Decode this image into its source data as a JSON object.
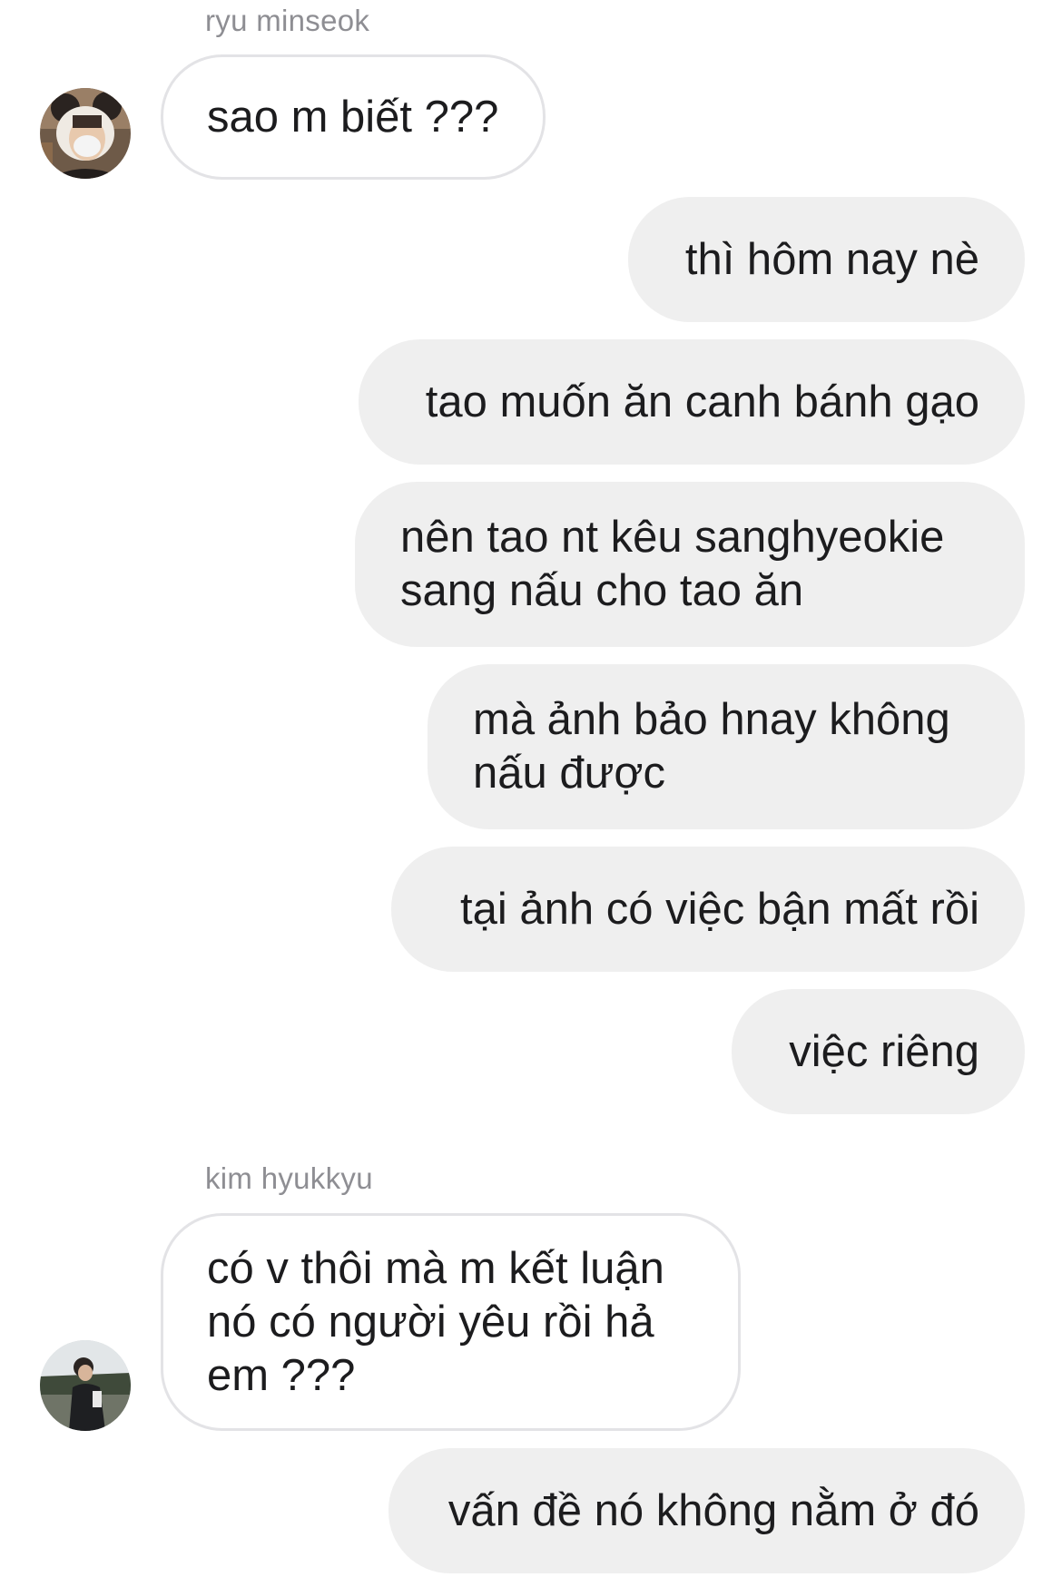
{
  "thread": {
    "messages": [
      {
        "sender": "ryu minseok",
        "text": "sao m biết ???"
      },
      {
        "sender": "me",
        "text": "thì hôm nay nè"
      },
      {
        "sender": "me",
        "text": "tao muốn ăn canh bánh gạo"
      },
      {
        "sender": "me",
        "text": "nên tao nt kêu sanghyeokie\nsang nấu cho tao ăn"
      },
      {
        "sender": "me",
        "text": "mà ảnh bảo hnay không\nnấu được"
      },
      {
        "sender": "me",
        "text": "tại ảnh có việc bận mất rồi"
      },
      {
        "sender": "me",
        "text": "việc riêng"
      },
      {
        "sender": "kim hyukkyu",
        "text": "có v thôi mà m kết luận\nnó có người yêu rồi hả\nem ???"
      },
      {
        "sender": "me",
        "text": "vấn đề nó không nằm ở đó"
      }
    ]
  },
  "senders": {
    "first": "ryu minseok",
    "second": "kim hyukkyu"
  },
  "avatars": {
    "first": {
      "icon": "avatar-photo-icon",
      "accent": "#d9d2c8"
    },
    "second": {
      "icon": "avatar-photo-icon",
      "accent": "#5b6b52"
    }
  },
  "colors": {
    "incoming_bg": "#ffffff",
    "incoming_border": "#e3e3e6",
    "outgoing_bg": "#efefef",
    "sender_name": "#8e8e93",
    "text": "#1c1c1e"
  }
}
